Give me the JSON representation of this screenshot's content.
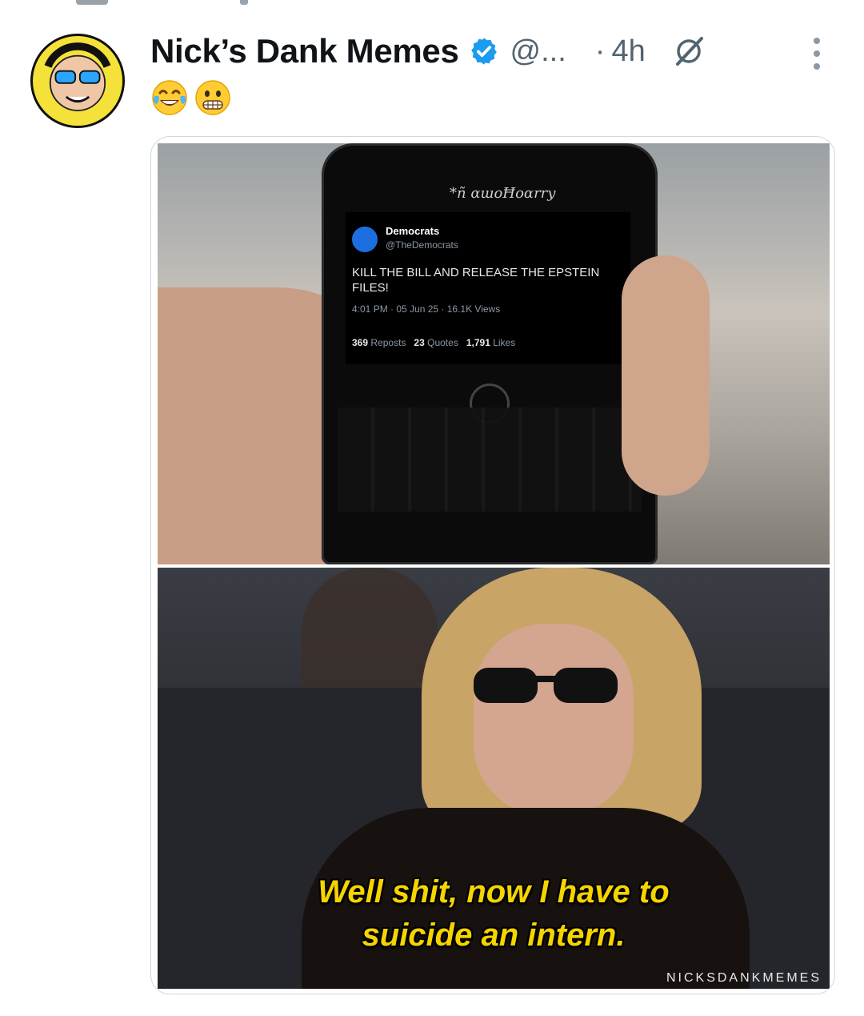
{
  "post": {
    "author_name": "Nick’s Dank Memes",
    "handle": "@...",
    "separator": "·",
    "time": "4h",
    "text": "😂😬"
  },
  "media": {
    "embedded_tweet": {
      "phone_brand": "*ñ ɑɯoĦoɑrry",
      "name": "Democrats",
      "handle": "@TheDemocrats",
      "text": "KILL THE BILL AND RELEASE THE EPSTEIN FILES!",
      "meta": "4:01 PM · 05 Jun 25 · 16.1K Views",
      "reposts_count": "369",
      "reposts_label": "Reposts",
      "quotes_count": "23",
      "quotes_label": "Quotes",
      "likes_count": "1,791",
      "likes_label": "Likes"
    },
    "caption_line1": "Well shit, now I have to",
    "caption_line2": "suicide an intern.",
    "watermark": "NICKSDANKMEMES"
  },
  "icons": {
    "verified": "verified-badge-icon",
    "grok": "grok-icon",
    "more": "more-vertical-icon"
  },
  "colors": {
    "verified_blue": "#1d9bf0",
    "secondary_text": "#536471",
    "caption_yellow": "#f5d400"
  }
}
